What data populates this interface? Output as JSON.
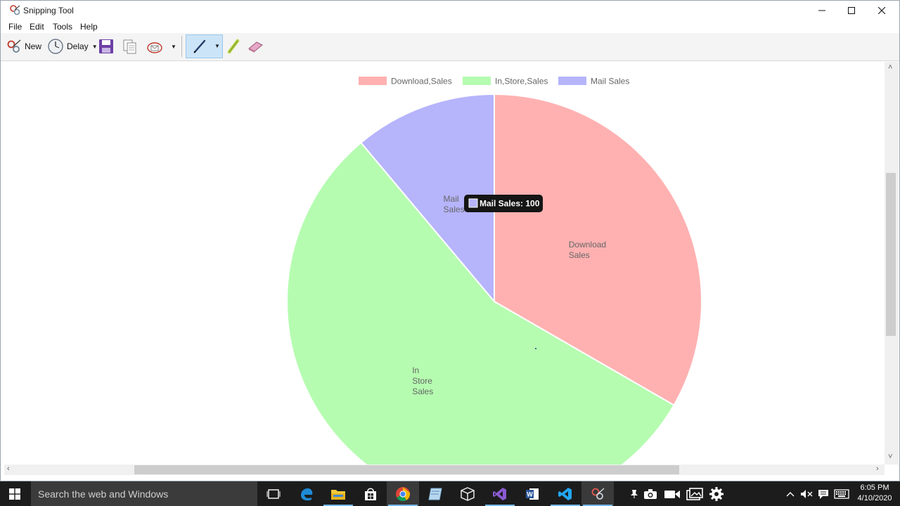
{
  "window": {
    "title": "Snipping Tool"
  },
  "menu": [
    "File",
    "Edit",
    "Tools",
    "Help"
  ],
  "toolbar": {
    "new_label": "New",
    "delay_label": "Delay"
  },
  "chart_data": {
    "type": "pie",
    "categories": [
      "Download,Sales",
      "In,Store,Sales",
      "Mail Sales"
    ],
    "slice_labels": [
      [
        "Download",
        "Sales"
      ],
      [
        "In",
        "Store",
        "Sales"
      ],
      [
        "Mail",
        "Sales"
      ]
    ],
    "values": [
      300,
      500,
      100
    ],
    "colors": [
      "#ffb1b1",
      "#b5fcb0",
      "#b6b4fb"
    ],
    "legend": "top",
    "tooltip": "Mail Sales: 100"
  },
  "taskbar": {
    "search_placeholder": "Search the web and Windows",
    "icons": [
      "task-view-icon",
      "edge-icon",
      "file-explorer-icon",
      "store-icon",
      "chrome-icon",
      "notepad-icon",
      "virtualbox-icon",
      "visual-studio-icon",
      "word-icon",
      "vscode-icon",
      "snipping-tool-icon"
    ],
    "time": "6:05 PM",
    "date": "4/10/2020"
  }
}
